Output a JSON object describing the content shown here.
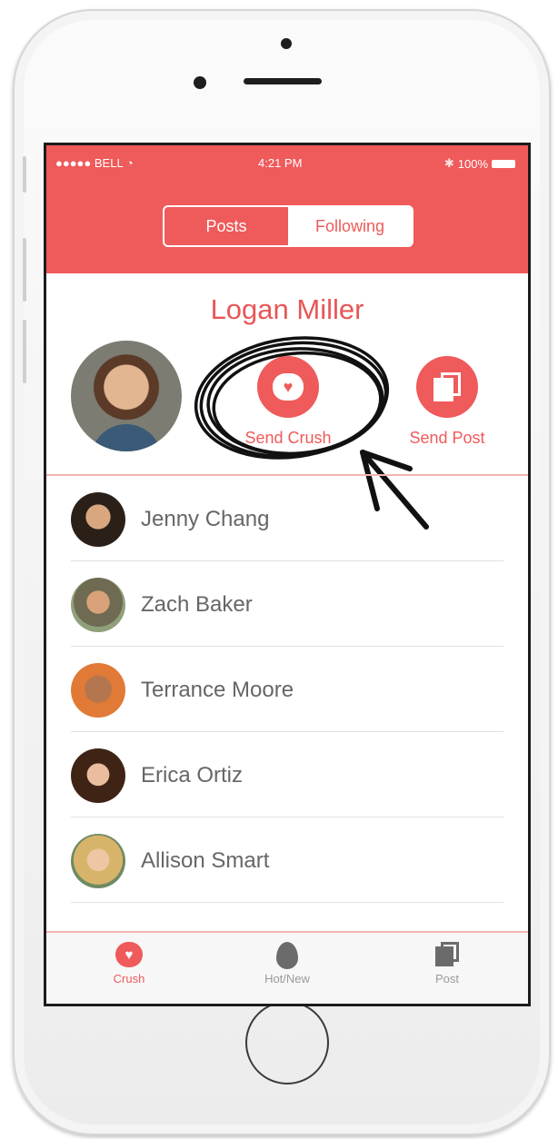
{
  "status_bar": {
    "carrier": "●●●●● BELL",
    "wifi_icon": "wifi-icon",
    "time": "4:21 PM",
    "battery": "100%"
  },
  "segmented": {
    "posts": "Posts",
    "following": "Following",
    "selected": "Following"
  },
  "profile": {
    "name": "Logan Miller",
    "send_crush": "Send Crush",
    "send_post": "Send Post"
  },
  "friends": [
    {
      "name": "Jenny Chang"
    },
    {
      "name": "Zach Baker"
    },
    {
      "name": "Terrance Moore"
    },
    {
      "name": "Erica Ortiz"
    },
    {
      "name": "Allison Smart"
    }
  ],
  "tabbar": {
    "crush": "Crush",
    "hot_new": "Hot/New",
    "post": "Post"
  },
  "colors": {
    "accent": "#ef5a5a",
    "list_text": "#666666"
  }
}
